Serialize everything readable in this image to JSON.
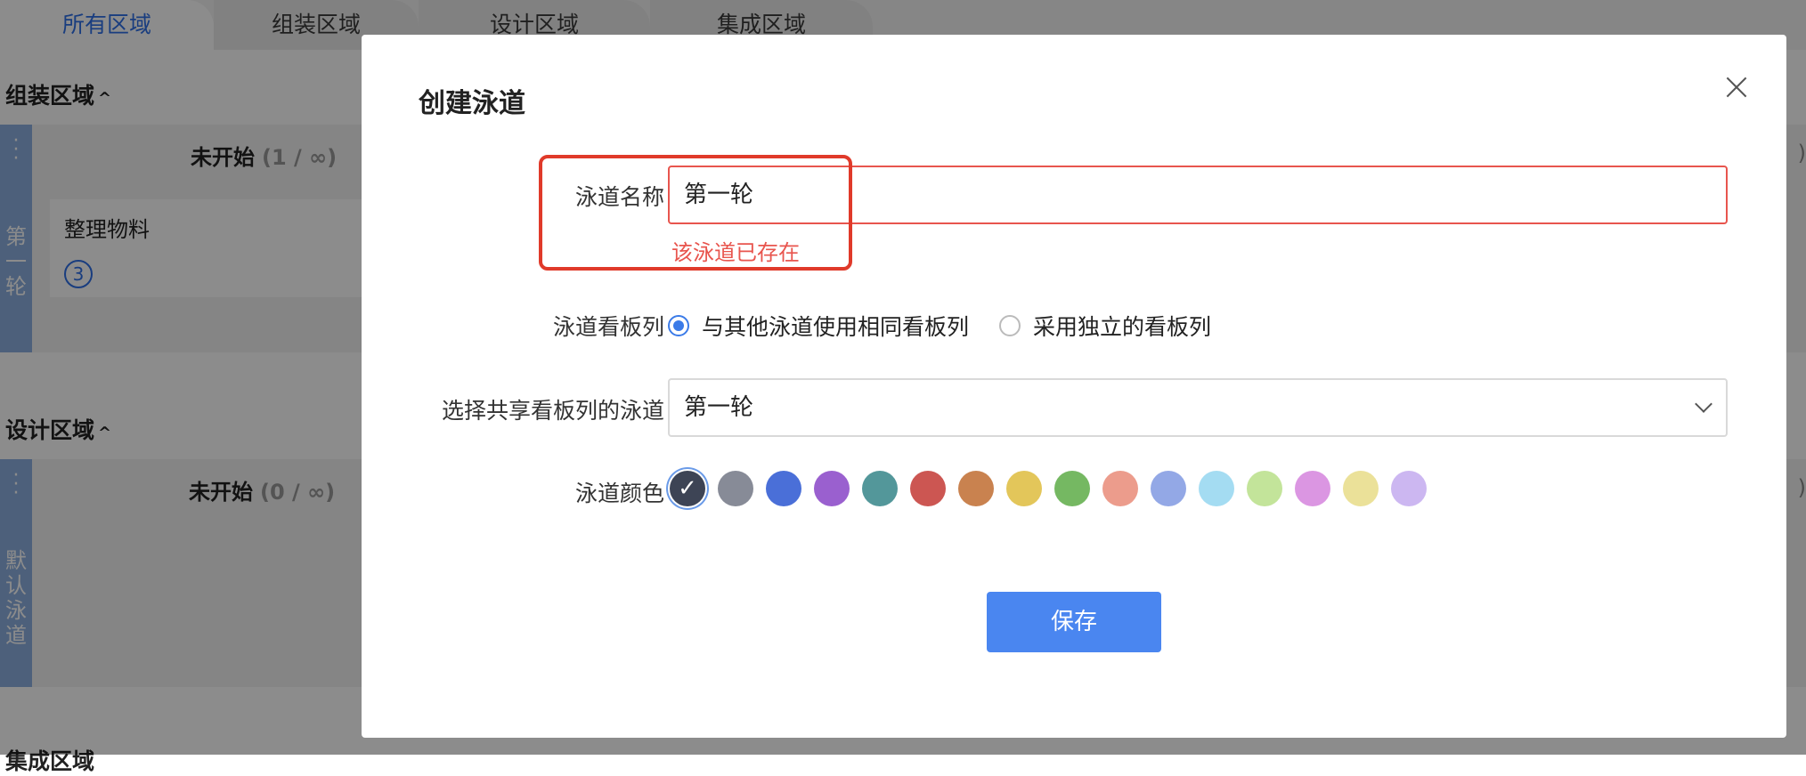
{
  "tabs": [
    "所有区域",
    "组装区域",
    "设计区域",
    "集成区域"
  ],
  "regions": {
    "assembly": {
      "title": "组装区域",
      "column": "未开始",
      "count": "(1 / ∞)",
      "lane_name": "第一轮",
      "card_title": "整理物料",
      "card_badge": "3"
    },
    "design": {
      "title": "设计区域",
      "column": "未开始",
      "count": "(0 / ∞)",
      "lane_name": "默认泳道"
    },
    "integration_partial": "集成区域"
  },
  "modal": {
    "title": "创建泳道",
    "name_label": "泳道名称",
    "name_value": "第一轮",
    "name_error": "该泳道已存在",
    "column_label": "泳道看板列",
    "option_same": "与其他泳道使用相同看板列",
    "option_independent": "采用独立的看板列",
    "share_label": "选择共享看板列的泳道",
    "share_value": "第一轮",
    "color_label": "泳道颜色",
    "colors": [
      "#3d4455",
      "#878b97",
      "#4a6fd8",
      "#9a60cf",
      "#53979a",
      "#cc5652",
      "#c9824f",
      "#e3c65a",
      "#75b862",
      "#ec9c8c",
      "#93a8e6",
      "#a4dcf2",
      "#c3e49a",
      "#db96e2",
      "#ebe199",
      "#ccb7f1"
    ],
    "selected_color": 0,
    "save_label": "保存"
  }
}
